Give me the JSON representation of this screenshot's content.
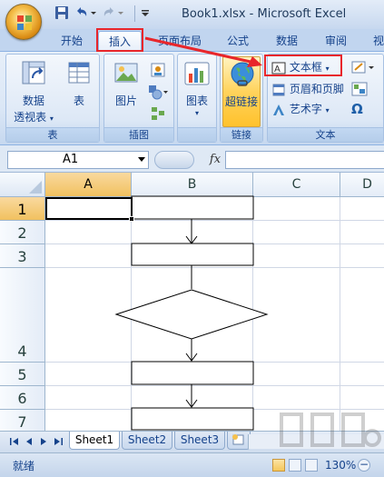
{
  "window": {
    "title": "Book1.xlsx - Microsoft Excel"
  },
  "tabs": [
    {
      "label": "开始"
    },
    {
      "label": "插入",
      "active": true
    },
    {
      "label": "页面布局"
    },
    {
      "label": "公式"
    },
    {
      "label": "数据"
    },
    {
      "label": "审阅"
    },
    {
      "label": "视"
    }
  ],
  "ribbon": {
    "groups": {
      "table": {
        "label": "表",
        "pivot_line1": "数据",
        "pivot_line2": "透视表",
        "table_btn": "表"
      },
      "illustrations": {
        "label": "插图",
        "picture_btn": "图片"
      },
      "charts": {
        "label": "",
        "chart_btn": "图表"
      },
      "links": {
        "label": "链接",
        "hyperlink_btn": "超链接"
      },
      "text": {
        "label": "文本",
        "textbox_btn": "文本框",
        "header_footer_btn": "页眉和页脚",
        "wordart_btn": "艺术字",
        "symbol_btn": "Ω"
      }
    }
  },
  "formula_bar": {
    "name_box": "A1",
    "fx": "fx",
    "value": ""
  },
  "grid": {
    "columns": [
      "A",
      "B",
      "C",
      "D"
    ],
    "rows": [
      "1",
      "2",
      "3",
      "4",
      "5",
      "6",
      "7"
    ],
    "selected_cell": "A1"
  },
  "sheets": [
    {
      "name": "Sheet1",
      "active": true
    },
    {
      "name": "Sheet2"
    },
    {
      "name": "Sheet3"
    }
  ],
  "status": {
    "text": "就绪",
    "zoom": "130%"
  },
  "colors": {
    "annotation_red": "#e8262b",
    "ribbon_text": "#15428b",
    "selected_header": "#f1c15f"
  }
}
